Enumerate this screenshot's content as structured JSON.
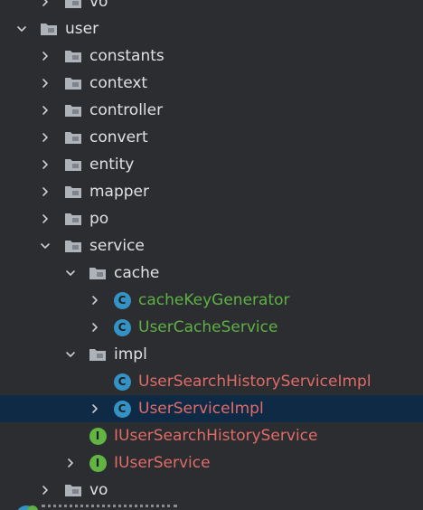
{
  "tree": [
    {
      "name": "row-vo-top",
      "label": "vo",
      "level": 2,
      "expander": "collapsed",
      "icon": "folder",
      "color": "default"
    },
    {
      "name": "row-user",
      "label": "user",
      "level": 1,
      "expander": "expanded",
      "icon": "folder",
      "color": "default"
    },
    {
      "name": "row-constants",
      "label": "constants",
      "level": 2,
      "expander": "collapsed",
      "icon": "folder",
      "color": "default"
    },
    {
      "name": "row-context",
      "label": "context",
      "level": 2,
      "expander": "collapsed",
      "icon": "folder",
      "color": "default"
    },
    {
      "name": "row-controller",
      "label": "controller",
      "level": 2,
      "expander": "collapsed",
      "icon": "folder",
      "color": "default"
    },
    {
      "name": "row-convert",
      "label": "convert",
      "level": 2,
      "expander": "collapsed",
      "icon": "folder",
      "color": "default"
    },
    {
      "name": "row-entity",
      "label": "entity",
      "level": 2,
      "expander": "collapsed",
      "icon": "folder",
      "color": "default"
    },
    {
      "name": "row-mapper",
      "label": "mapper",
      "level": 2,
      "expander": "collapsed",
      "icon": "folder",
      "color": "default"
    },
    {
      "name": "row-po",
      "label": "po",
      "level": 2,
      "expander": "collapsed",
      "icon": "folder",
      "color": "default"
    },
    {
      "name": "row-service",
      "label": "service",
      "level": 2,
      "expander": "expanded",
      "icon": "folder",
      "color": "default"
    },
    {
      "name": "row-cache",
      "label": "cache",
      "level": 3,
      "expander": "expanded",
      "icon": "folder",
      "color": "default"
    },
    {
      "name": "row-cachekeygenerator",
      "label": "cacheKeyGenerator",
      "level": 4,
      "expander": "collapsed",
      "icon": "class",
      "badge": "C",
      "color": "green"
    },
    {
      "name": "row-usercacheservice",
      "label": "UserCacheService",
      "level": 4,
      "expander": "collapsed",
      "icon": "class",
      "badge": "C",
      "color": "green"
    },
    {
      "name": "row-impl",
      "label": "impl",
      "level": 3,
      "expander": "expanded",
      "icon": "folder",
      "color": "default"
    },
    {
      "name": "row-usersearchhistoryserviceimpl",
      "label": "UserSearchHistoryServiceImpl",
      "level": 4,
      "expander": "none",
      "icon": "class",
      "badge": "C",
      "color": "red"
    },
    {
      "name": "row-userserviceimpl",
      "label": "UserServiceImpl",
      "level": 4,
      "expander": "collapsed",
      "icon": "class",
      "badge": "C",
      "color": "red",
      "selected": true
    },
    {
      "name": "row-iusersearchhistoryservice",
      "label": "IUserSearchHistoryService",
      "level": 3,
      "expander": "none",
      "icon": "interface",
      "badge": "I",
      "color": "red"
    },
    {
      "name": "row-iuserservice",
      "label": "IUserService",
      "level": 3,
      "expander": "collapsed",
      "icon": "interface",
      "badge": "I",
      "color": "red"
    },
    {
      "name": "row-vo",
      "label": "vo",
      "level": 2,
      "expander": "collapsed",
      "icon": "folder",
      "color": "default"
    }
  ],
  "colors": {
    "background": "#2b2d30",
    "selection": "#0f2a44",
    "default_text": "#dfe1e5",
    "green_text": "#5fb045",
    "red_text": "#e06c68",
    "class_badge": "#3592c4",
    "interface_badge": "#62b543",
    "folder_icon": "#aeb3ba"
  }
}
